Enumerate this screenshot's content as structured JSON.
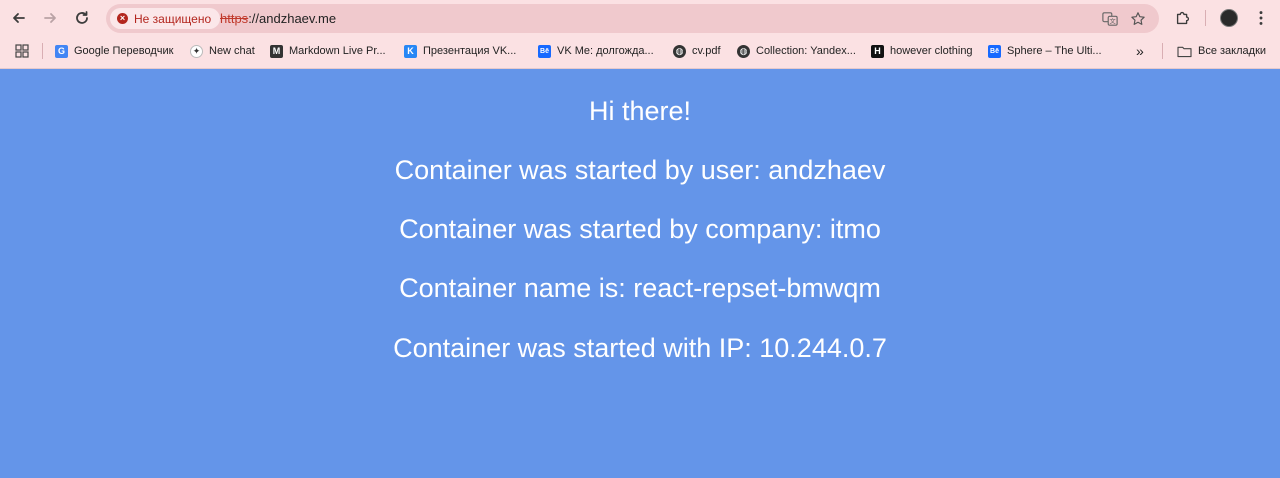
{
  "browser": {
    "address_bar": {
      "security_label": "Не защищено",
      "url_scheme": "https",
      "url_rest": "://andzhaev.me"
    },
    "bookmarks": [
      {
        "label": "Google Переводчик",
        "icon": "google-translate-icon",
        "color": "#4285f4",
        "glyph": "G"
      },
      {
        "label": "New chat",
        "icon": "openai-icon",
        "color": "#ffffff",
        "glyph": "⚙"
      },
      {
        "label": "Markdown Live Pr...",
        "icon": "markdown-icon",
        "color": "#333333",
        "glyph": "M"
      },
      {
        "label": "Презентация VK...",
        "icon": "vk-icon",
        "color": "#2787f5",
        "glyph": "K"
      },
      {
        "label": "VK Me: долгожда...",
        "icon": "behance-icon",
        "color": "#1769ff",
        "glyph": "Bē"
      },
      {
        "label": "cv.pdf",
        "icon": "globe-icon",
        "color": "#333333",
        "glyph": "◉"
      },
      {
        "label": "Collection: Yandex...",
        "icon": "globe-icon",
        "color": "#333333",
        "glyph": "◉"
      },
      {
        "label": "however clothing",
        "icon": "however-icon",
        "color": "#111111",
        "glyph": "H"
      },
      {
        "label": "Sphere – The Ulti...",
        "icon": "behance-icon",
        "color": "#1769ff",
        "glyph": "Bē"
      }
    ],
    "all_bookmarks_label": "Все закладки"
  },
  "page": {
    "greeting": "Hi there!",
    "user_line": "Container was started by user: andzhaev",
    "company_line": "Container was started by company: itmo",
    "name_line": "Container name is: react-repset-bmwqm",
    "ip_line": "Container was started with IP: 10.244.0.7"
  },
  "colors": {
    "page_background": "#6495e9",
    "chrome_background": "#fbe1e3",
    "insecure_red": "#b3261e"
  }
}
